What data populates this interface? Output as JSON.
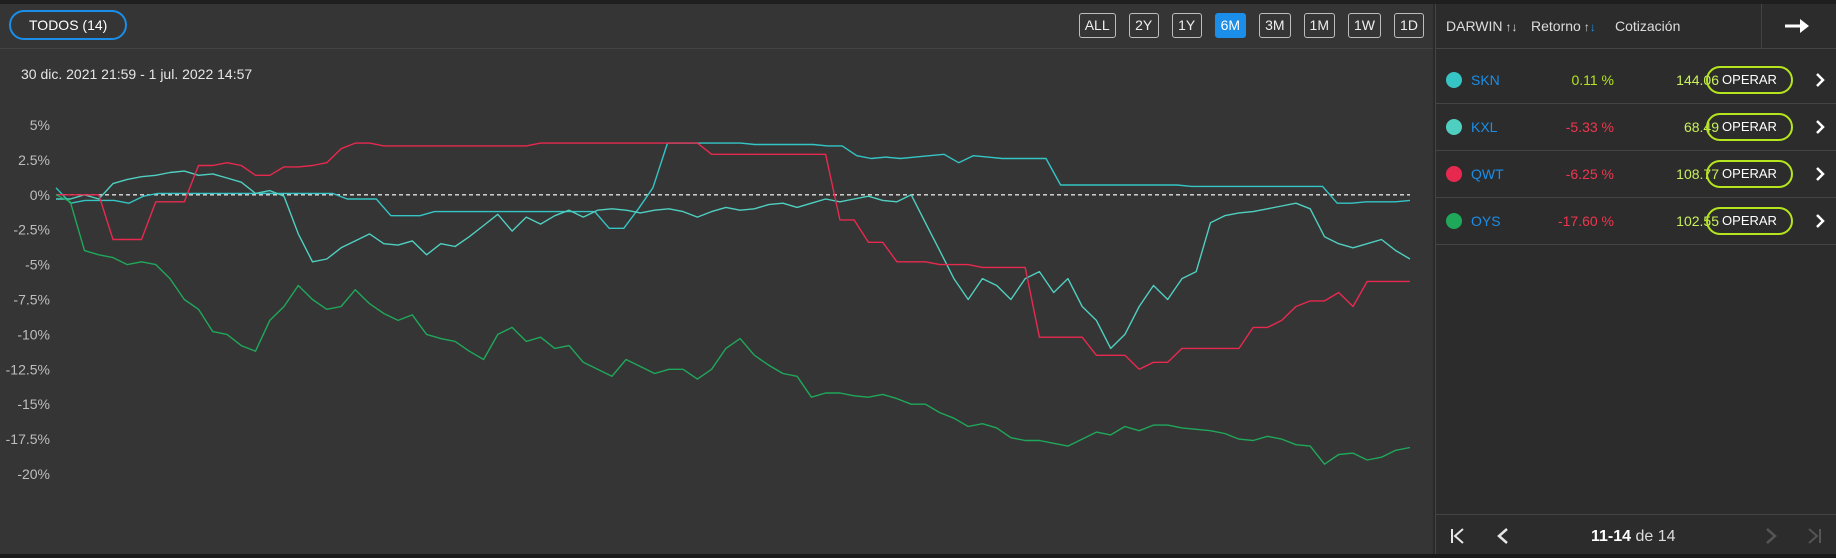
{
  "filter": {
    "todos_label": "TODOS (14)"
  },
  "periods": [
    "ALL",
    "2Y",
    "1Y",
    "6M",
    "3M",
    "1M",
    "1W",
    "1D"
  ],
  "active_period": "6M",
  "date_range": "30 dic. 2021 21:59 - 1 jul. 2022 14:57",
  "table": {
    "col_darwin": "DARWIN",
    "col_return": "Retorno",
    "col_quote": "Cotización",
    "sort_arrows": "↑↓",
    "rows": [
      {
        "name": "SKN",
        "return": "0.11 %",
        "quote": "144.06",
        "action": "OPERAR",
        "color": "#35c5c5",
        "return_color": "#b5e61d"
      },
      {
        "name": "KXL",
        "return": "-5.33 %",
        "quote": "68.49",
        "action": "OPERAR",
        "color": "#4fcfc0",
        "return_color": "#f0364e"
      },
      {
        "name": "QWT",
        "return": "-6.25 %",
        "quote": "108.77",
        "action": "OPERAR",
        "color": "#e8294f",
        "return_color": "#f0364e"
      },
      {
        "name": "OYS",
        "return": "-17.60 %",
        "quote": "102.55",
        "action": "OPERAR",
        "color": "#1fa85a",
        "return_color": "#f0364e"
      }
    ]
  },
  "pagination": {
    "range": "11-14",
    "of_label": "de",
    "total": "14"
  },
  "icons": [
    "exit-arrow-icon",
    "chevron-right-icon",
    "first-page-icon",
    "prev-page-icon",
    "next-page-icon",
    "last-page-icon"
  ],
  "chart_data": {
    "type": "line",
    "y_ticks": [
      "5%",
      "2.5%",
      "0%",
      "-2.5%",
      "-5%",
      "-7.5%",
      "-10%",
      "-12.5%",
      "-15%",
      "-17.5%",
      "-20%"
    ],
    "ylim": [
      -20,
      5
    ],
    "zero_line": "dashed",
    "series": [
      {
        "name": "SKN",
        "color": "#35c5c5",
        "values": [
          0.5,
          -0.6,
          -0.4,
          -0.4,
          -0.4,
          -0.6,
          -0.1,
          0.1,
          0.1,
          0.1,
          0.1,
          0.1,
          0.1,
          0.1,
          0.1,
          0.1,
          0.1,
          0.1,
          0.1,
          0.1,
          -0.3,
          -0.3,
          -0.3,
          -1.5,
          -1.5,
          -1.5,
          -1.2,
          -1.2,
          -1.2,
          -1.2,
          -1.2,
          -1.2,
          -1.2,
          -1.2,
          -1.2,
          -1.2,
          -1.2,
          -1.2,
          -2.4,
          -2.4,
          -1.0,
          0.5,
          3.7,
          3.7,
          3.7,
          3.7,
          3.7,
          3.7,
          3.6,
          3.6,
          3.6,
          3.6,
          3.6,
          3.5,
          3.5,
          2.8,
          2.6,
          2.7,
          2.6,
          2.7,
          2.8,
          2.9,
          2.3,
          2.8,
          2.7,
          2.6,
          2.6,
          2.6,
          2.6,
          0.7,
          0.7,
          0.7,
          0.7,
          0.7,
          0.7,
          0.7,
          0.7,
          0.7,
          0.6,
          0.6,
          0.6,
          0.6,
          0.6,
          0.6,
          0.6,
          0.6,
          0.6,
          0.6,
          -0.6,
          -0.6,
          -0.5,
          -0.5,
          -0.5,
          -0.4
        ]
      },
      {
        "name": "KXL",
        "color": "#4fcfc0",
        "values": [
          -0.3,
          -0.3,
          0.0,
          -0.3,
          0.8,
          1.1,
          1.3,
          1.4,
          1.6,
          1.7,
          1.4,
          1.5,
          1.2,
          0.9,
          0.1,
          0.3,
          -0.1,
          -2.8,
          -4.8,
          -4.6,
          -3.8,
          -3.3,
          -2.8,
          -3.5,
          -3.6,
          -3.3,
          -4.3,
          -3.5,
          -3.7,
          -3.0,
          -2.2,
          -1.4,
          -2.6,
          -1.6,
          -2.1,
          -1.5,
          -1.1,
          -1.6,
          -1.1,
          -1.0,
          -1.1,
          -1.3,
          -1.1,
          -1.0,
          -1.2,
          -1.6,
          -1.2,
          -0.9,
          -1.1,
          -1.0,
          -0.7,
          -0.6,
          -0.9,
          -0.6,
          -0.3,
          -0.5,
          -0.3,
          -0.1,
          -0.4,
          -0.5,
          0.0,
          -2.0,
          -4.0,
          -6.0,
          -7.5,
          -6.0,
          -6.5,
          -7.5,
          -6.0,
          -5.5,
          -7.0,
          -6.0,
          -8.0,
          -9.0,
          -11.0,
          -10.0,
          -8.0,
          -6.5,
          -7.5,
          -6.0,
          -5.5,
          -2.0,
          -1.5,
          -1.3,
          -1.2,
          -1.0,
          -0.8,
          -0.6,
          -1.0,
          -3.0,
          -3.5,
          -3.8,
          -3.5,
          -3.2,
          -4.0,
          -4.6
        ]
      },
      {
        "name": "QWT",
        "color": "#e8294f",
        "values": [
          0.0,
          0.0,
          0.0,
          0.0,
          -3.2,
          -3.2,
          -3.2,
          -0.5,
          -0.5,
          -0.5,
          2.1,
          2.1,
          2.3,
          2.1,
          1.4,
          1.4,
          2.0,
          2.0,
          2.1,
          2.3,
          3.3,
          3.7,
          3.7,
          3.5,
          3.5,
          3.5,
          3.5,
          3.5,
          3.5,
          3.5,
          3.5,
          3.5,
          3.5,
          3.5,
          3.7,
          3.7,
          3.7,
          3.7,
          3.7,
          3.7,
          3.7,
          3.7,
          3.7,
          3.7,
          3.7,
          3.7,
          2.9,
          2.9,
          2.9,
          2.9,
          2.9,
          2.9,
          2.9,
          2.9,
          2.9,
          -1.8,
          -1.8,
          -3.4,
          -3.4,
          -4.8,
          -4.8,
          -4.8,
          -5.0,
          -5.0,
          -5.0,
          -5.2,
          -5.2,
          -5.2,
          -5.2,
          -10.2,
          -10.2,
          -10.2,
          -10.2,
          -11.5,
          -11.5,
          -11.5,
          -12.5,
          -12.0,
          -12.0,
          -11.0,
          -11.0,
          -11.0,
          -11.0,
          -11.0,
          -9.5,
          -9.5,
          -9.0,
          -8.0,
          -7.6,
          -7.6,
          -7.0,
          -8.0,
          -6.2,
          -6.2,
          -6.2,
          -6.2
        ]
      },
      {
        "name": "OYS",
        "color": "#1fa85a",
        "values": [
          0.0,
          -0.5,
          -4.0,
          -4.3,
          -4.5,
          -5.0,
          -4.8,
          -5.0,
          -6.0,
          -7.5,
          -8.2,
          -9.8,
          -10.0,
          -10.8,
          -11.2,
          -9.0,
          -8.0,
          -6.5,
          -7.5,
          -8.2,
          -8.0,
          -6.8,
          -7.8,
          -8.5,
          -9.0,
          -8.6,
          -10.0,
          -10.3,
          -10.5,
          -11.2,
          -11.8,
          -10.0,
          -9.5,
          -10.5,
          -10.2,
          -11.0,
          -10.8,
          -12.0,
          -12.5,
          -13.0,
          -11.8,
          -12.3,
          -12.8,
          -12.5,
          -12.5,
          -13.2,
          -12.5,
          -11.0,
          -10.3,
          -11.5,
          -12.2,
          -12.8,
          -13.0,
          -14.5,
          -14.2,
          -14.2,
          -14.4,
          -14.5,
          -14.3,
          -14.6,
          -15.0,
          -15.0,
          -15.6,
          -16.0,
          -16.6,
          -16.4,
          -16.7,
          -17.4,
          -17.6,
          -17.6,
          -17.8,
          -18.0,
          -17.5,
          -17.0,
          -17.2,
          -16.6,
          -16.9,
          -16.5,
          -16.5,
          -16.7,
          -16.8,
          -16.9,
          -17.1,
          -17.5,
          -17.6,
          -17.3,
          -17.5,
          -17.9,
          -18.0,
          -19.3,
          -18.6,
          -18.5,
          -19.0,
          -18.8,
          -18.3,
          -18.1
        ]
      }
    ]
  }
}
